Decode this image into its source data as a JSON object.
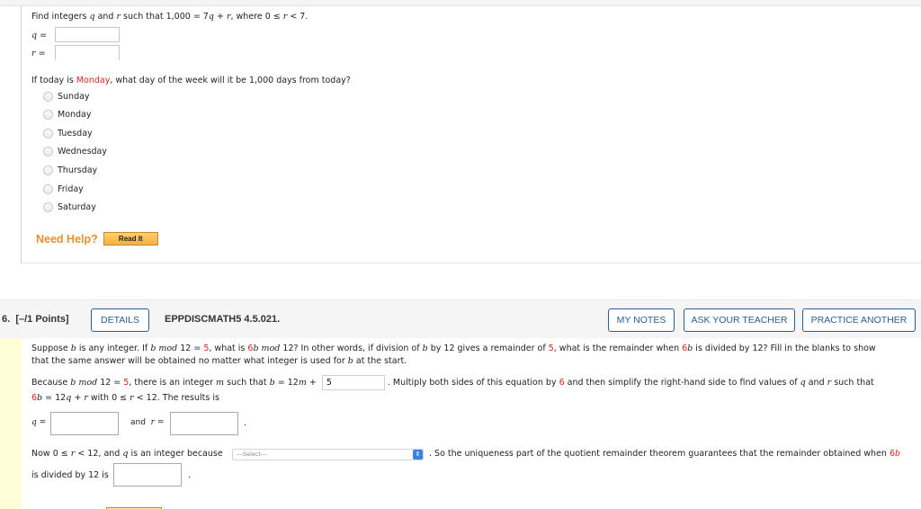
{
  "q5": {
    "prompt_parts": [
      "Find integers ",
      "q",
      " and ",
      "r",
      " such that 1,000 = 7",
      "q",
      " + ",
      "r",
      ", where 0 ≤ ",
      "r",
      " < 7."
    ],
    "q_label": "q",
    "r_label": "r",
    "eq": "=",
    "q_value": "",
    "r_value": "",
    "day_prompt_before": "If today is ",
    "day_highlight": "Monday",
    "day_prompt_after": ", what day of the week will it be 1,000 days from today?",
    "options": [
      "Sunday",
      "Monday",
      "Tuesday",
      "Wednesday",
      "Thursday",
      "Friday",
      "Saturday"
    ],
    "need_help": "Need Help?",
    "read_it": "Read It"
  },
  "q6": {
    "number": "6.",
    "points": "[–/1 Points]",
    "details_label": "DETAILS",
    "code": "EPPDISCMATH5 4.5.021.",
    "my_notes_label": "MY NOTES",
    "ask_teacher_label": "ASK YOUR TEACHER",
    "practice_another_label": "PRACTICE ANOTHER",
    "intro_line1": {
      "a": "Suppose ",
      "b": "b",
      "c": " is any integer. If ",
      "d": "b mod",
      "e": " 12 = ",
      "f": "5",
      "g": ", what is ",
      "h": "6",
      "i": "b mod",
      "j": " 12? In other words, if division of ",
      "k": "b",
      "l": " by 12 gives a remainder of ",
      "m": "5",
      "n": ", what is the remainder when ",
      "o": "6",
      "p": "b",
      "q": " is divided by 12? Fill in the blanks to show"
    },
    "intro_line2": {
      "a": "that the same answer will be obtained no matter what integer is used for ",
      "b": "b",
      "c": " at the start."
    },
    "because_line": {
      "a": "Because ",
      "b": "b mod",
      "c": " 12 = ",
      "d": "5",
      "e": ", there is an integer ",
      "f": "m",
      "g": " such that ",
      "h": "b",
      "i": " = 12",
      "j": "m",
      "k": " + ",
      "input_value": "5",
      "l": ". Multiply both sides of this equation by ",
      "m": "6",
      "n": " and then simplify the right-hand side to find values of ",
      "o": "q",
      "p": " and ",
      "q": "r",
      "r": " such that"
    },
    "result_line": {
      "a": "6",
      "b": "b",
      "c": " = 12",
      "d": "q",
      "e": " + ",
      "f": "r",
      "g": " with 0 ≤ ",
      "h": "r",
      "i": " < 12. The results is"
    },
    "q_label": "q =",
    "and_label": "and",
    "r_label": "r =",
    "period": ".",
    "q_value": "",
    "r_value": "",
    "now_line": {
      "a": "Now 0 ≤ ",
      "b": "r",
      "c": " < 12, and ",
      "d": "q",
      "e": " is an integer because"
    },
    "select_value": "---Select---",
    "uniq_line": {
      "a": ". So the uniqueness part of the quotient remainder theorem guarantees that the remainder obtained when ",
      "b": "6",
      "c": "b"
    },
    "divided_line": "is divided by 12 is",
    "remainder_value": ""
  },
  "colors": {
    "highlight_red": "#d7261e",
    "button_blue": "#2a5d8f",
    "help_orange": "#e8902c",
    "side_yellow": "#fffdd8"
  }
}
